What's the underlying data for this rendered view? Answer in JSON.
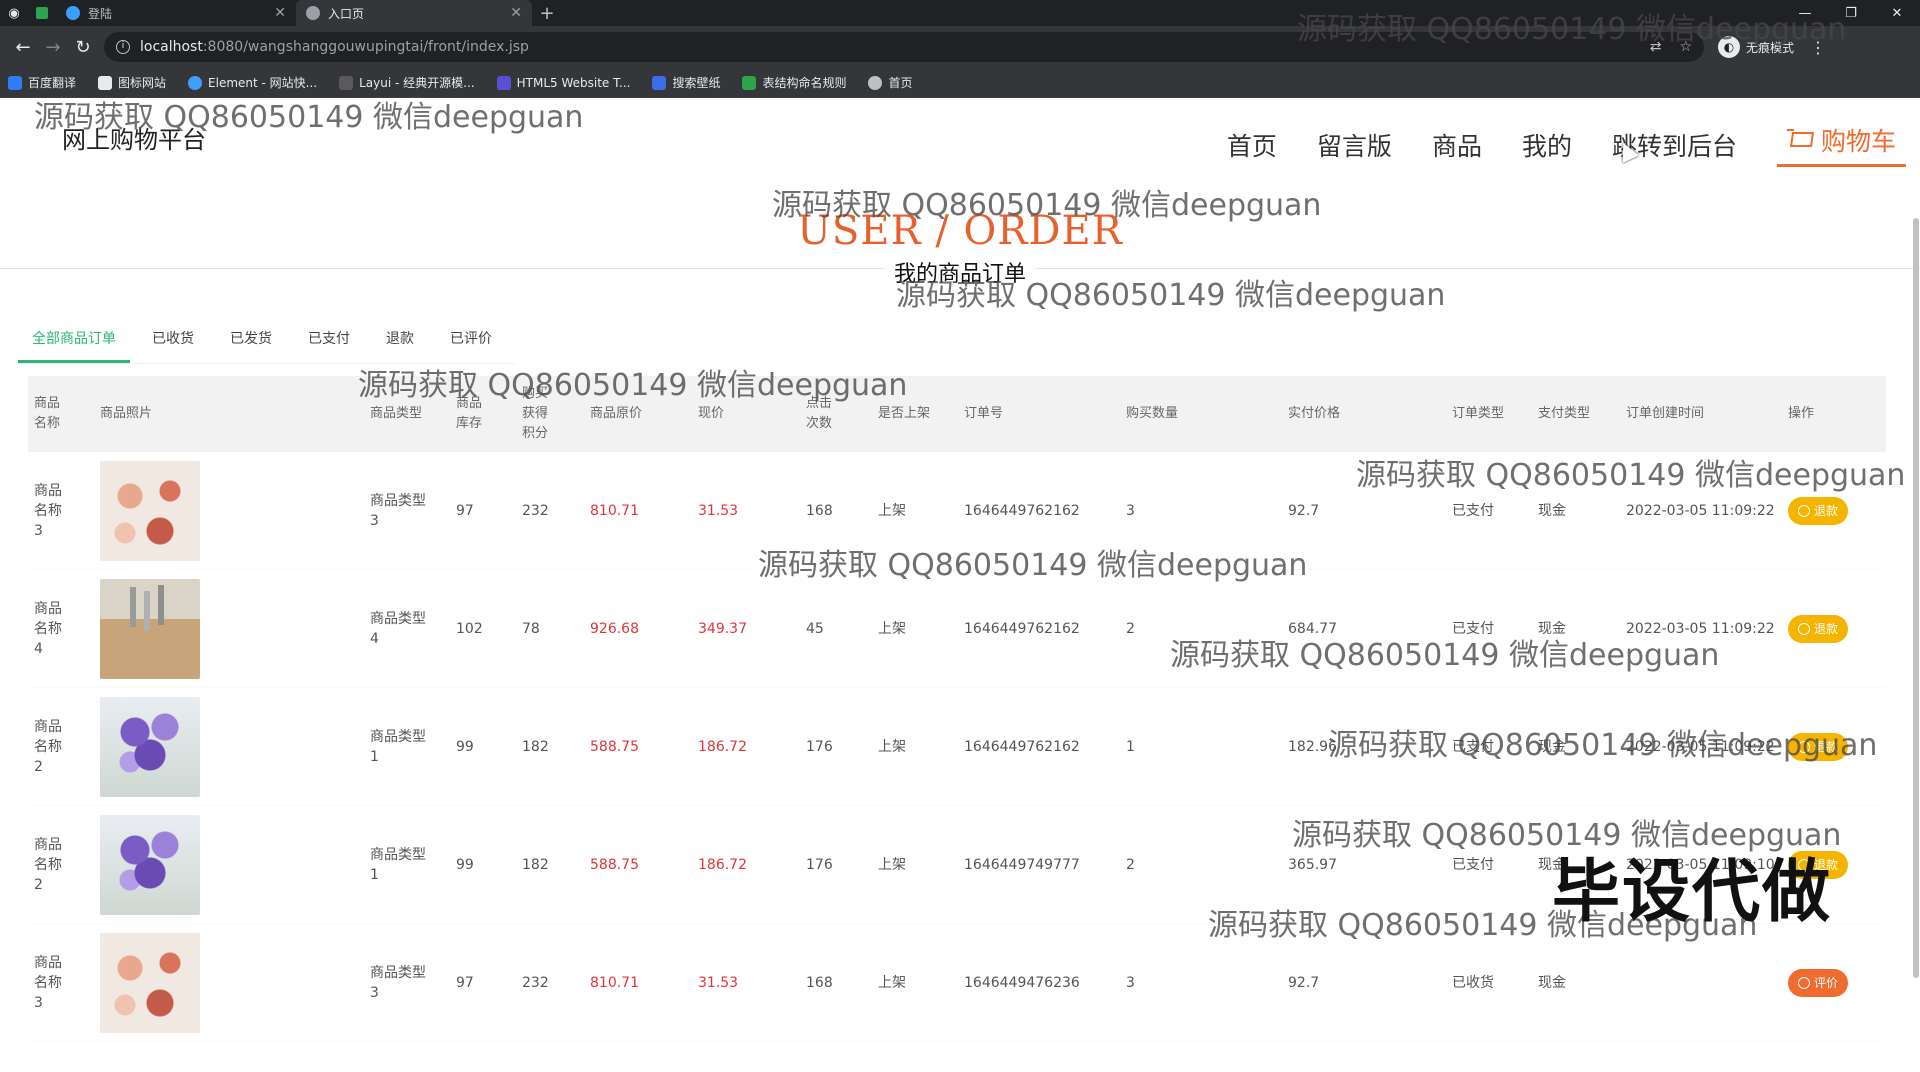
{
  "browser": {
    "tabs": [
      {
        "label": "登陆",
        "active": false
      },
      {
        "label": "入口页",
        "active": true
      }
    ],
    "url_host": "localhost",
    "url_path": ":8080/wangshanggouwupingtai/front/index.jsp",
    "incognito_label": "无痕模式",
    "bookmarks": [
      "百度翻译",
      "图标网站",
      "Element - 网站快...",
      "Layui - 经典开源模...",
      "HTML5 Website T...",
      "搜索壁纸",
      "表结构命名规则",
      "首页"
    ]
  },
  "site": {
    "brand": "网上购物平台",
    "nav": {
      "home": "首页",
      "guestbook": "留言版",
      "goods": "商品",
      "mine": "我的",
      "admin": "跳转到后台",
      "cart": "购物车"
    },
    "hero_title": "USER / ORDER",
    "hero_subtitle": "我的商品订单"
  },
  "order_tabs": [
    "全部商品订单",
    "已收货",
    "已发货",
    "已支付",
    "退款",
    "已评价"
  ],
  "table": {
    "headers": [
      "商品名称",
      "商品照片",
      "商品类型",
      "商品库存",
      "购买获得积分",
      "商品原价",
      "现价",
      "点击次数",
      "是否上架",
      "订单号",
      "购买数量",
      "实付价格",
      "订单类型",
      "支付类型",
      "订单创建时间",
      "操作"
    ],
    "rows": [
      {
        "name": "商品名称3",
        "photo": "cosmetics-photo",
        "type": "商品类型3",
        "stock": "97",
        "points": "232",
        "orig_price": "810.71",
        "price": "31.53",
        "clicks": "168",
        "on_sale": "上架",
        "order_no": "1646449762162",
        "qty": "3",
        "paid": "92.7",
        "order_type": "已支付",
        "pay_type": "现金",
        "created": "2022-03-05 11:09:22",
        "action": "退款"
      },
      {
        "name": "商品名称4",
        "photo": "knife-set-photo",
        "type": "商品类型4",
        "stock": "102",
        "points": "78",
        "orig_price": "926.68",
        "price": "349.37",
        "clicks": "45",
        "on_sale": "上架",
        "order_no": "1646449762162",
        "qty": "2",
        "paid": "684.77",
        "order_type": "已支付",
        "pay_type": "现金",
        "created": "2022-03-05 11:09:22",
        "action": "退款"
      },
      {
        "name": "商品名称2",
        "photo": "flowers-photo",
        "type": "商品类型1",
        "stock": "99",
        "points": "182",
        "orig_price": "588.75",
        "price": "186.72",
        "clicks": "176",
        "on_sale": "上架",
        "order_no": "1646449762162",
        "qty": "1",
        "paid": "182.96",
        "order_type": "已支付",
        "pay_type": "现金",
        "created": "2022-03-05 11:09:22",
        "action": "退款"
      },
      {
        "name": "商品名称2",
        "photo": "flowers-photo",
        "type": "商品类型1",
        "stock": "99",
        "points": "182",
        "orig_price": "588.75",
        "price": "186.72",
        "clicks": "176",
        "on_sale": "上架",
        "order_no": "1646449749777",
        "qty": "2",
        "paid": "365.97",
        "order_type": "已支付",
        "pay_type": "现金",
        "created": "2022-03-05 11:09:10",
        "action": "退款"
      },
      {
        "name": "商品名称3",
        "photo": "cosmetics-photo",
        "type": "商品类型3",
        "stock": "97",
        "points": "232",
        "orig_price": "810.71",
        "price": "31.53",
        "clicks": "168",
        "on_sale": "上架",
        "order_no": "1646449476236",
        "qty": "3",
        "paid": "92.7",
        "order_type": "已收货",
        "pay_type": "现金",
        "created": "",
        "action": "评价"
      }
    ]
  },
  "watermarks": {
    "text": "源码获取 QQ86050149 微信deepguan",
    "stamp": "毕设代做"
  },
  "colors": {
    "accent_orange": "#f06b2e",
    "tab_active_green": "#2bb673",
    "price_red": "#e0353b",
    "refund_button_yellow": "#f5b400"
  }
}
